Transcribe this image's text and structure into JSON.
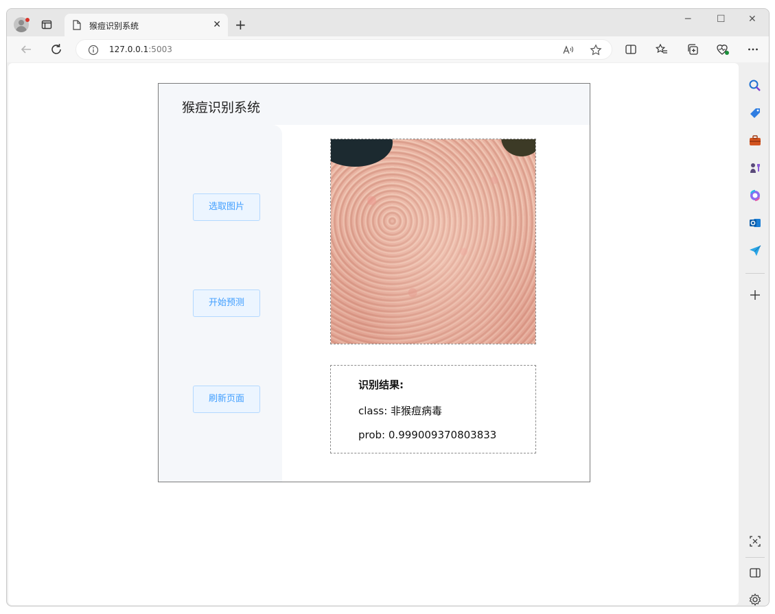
{
  "browser": {
    "tab_title": "猴痘识别系统",
    "tab_close": "✕",
    "new_tab": "+",
    "url_host": "127.0.0.1",
    "url_port": ":5003",
    "window_controls": [
      "─",
      "☐",
      "✕"
    ]
  },
  "app": {
    "title": "猴痘识别系统",
    "buttons": {
      "select_image": "选取图片",
      "start_predict": "开始预测",
      "refresh_page": "刷新页面"
    },
    "result": {
      "heading": "识别结果:",
      "class_line": "class: 非猴痘病毒",
      "prob_line": "prob: 0.999009370803833"
    }
  },
  "colors": {
    "button_bg": "#ecf5ff",
    "button_border": "#b3d8ff",
    "button_text": "#409eff",
    "aside_bg": "#f5f7fa"
  },
  "icons": {
    "sidebar": [
      "search-icon",
      "tag-icon",
      "toolbox-icon",
      "chess-icon",
      "copilot-icon",
      "outlook-icon",
      "send-icon",
      "add-icon",
      "screenshot-icon",
      "sidebar-toggle-icon",
      "settings-icon"
    ]
  }
}
